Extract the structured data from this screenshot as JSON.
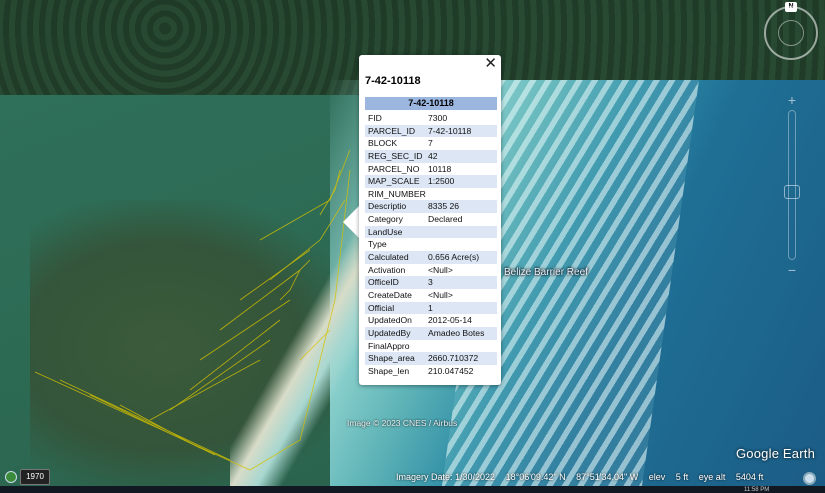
{
  "popup": {
    "title": "7-42-10118",
    "close_icon": "close-icon",
    "table_header": "7-42-10118",
    "rows": [
      {
        "key": "FID",
        "value": "7300"
      },
      {
        "key": "PARCEL_ID",
        "value": "7-42-10118"
      },
      {
        "key": "BLOCK",
        "value": "7"
      },
      {
        "key": "REG_SEC_ID",
        "value": "42"
      },
      {
        "key": "PARCEL_NO",
        "value": "10118"
      },
      {
        "key": "MAP_SCALE",
        "value": "1:2500"
      },
      {
        "key": "RIM_NUMBER",
        "value": ""
      },
      {
        "key": "Descriptio",
        "value": "8335 26"
      },
      {
        "key": "Category",
        "value": "Declared"
      },
      {
        "key": "LandUse",
        "value": ""
      },
      {
        "key": "Type",
        "value": ""
      },
      {
        "key": "Calculated",
        "value": "0.656 Acre(s)"
      },
      {
        "key": "Activation",
        "value": "<Null>"
      },
      {
        "key": "OfficeID",
        "value": "3"
      },
      {
        "key": "CreateDate",
        "value": "<Null>"
      },
      {
        "key": "Official",
        "value": "1"
      },
      {
        "key": "UpdatedOn",
        "value": "2012-05-14"
      },
      {
        "key": "UpdatedBy",
        "value": "Amadeo Botes"
      },
      {
        "key": "FinalAppro",
        "value": ""
      },
      {
        "key": "Shape_area",
        "value": "2660.710372"
      },
      {
        "key": "Shape_len",
        "value": "210.047452"
      }
    ]
  },
  "map": {
    "place_label": "Belize Barrier Reef",
    "image_credit": "Image © 2023 CNES / Airbus",
    "brand": "Google Earth"
  },
  "status_bar": {
    "imagery_date": "Imagery Date: 1/30/2022",
    "lat": "18°06'09.42\" N",
    "lon": "87°51'34.04\" W",
    "elev_label": "elev",
    "elev_value": "5 ft",
    "eye_alt_label": "eye alt",
    "eye_alt_value": "5404 ft"
  },
  "historical_imagery": {
    "year": "1970"
  },
  "navigation": {
    "north_label": "N",
    "zoom_in": "+",
    "zoom_out": "−"
  },
  "taskbar": {
    "clock": "11:58 PM"
  },
  "colors": {
    "table_header_bg": "#9bb7df",
    "row_alt_bg": "#dce6f4",
    "parcel_line": "#d4c200"
  }
}
